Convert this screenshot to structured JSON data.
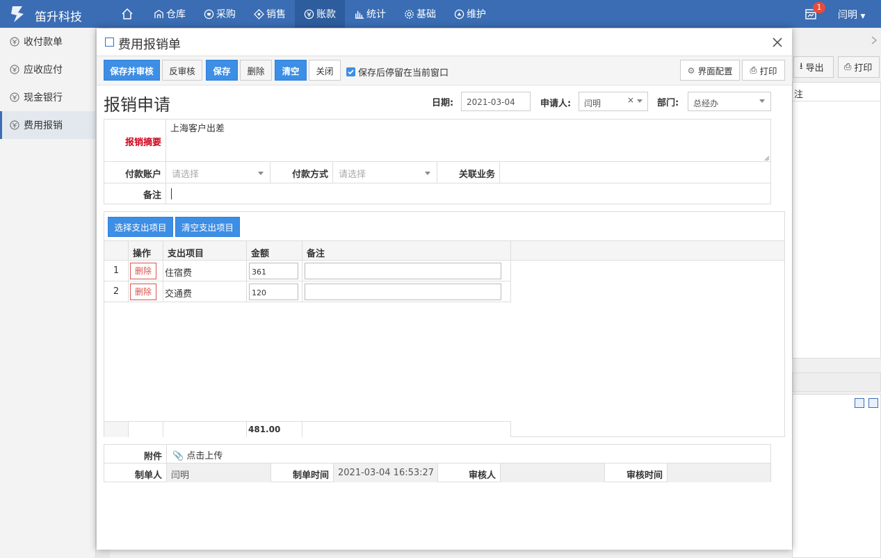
{
  "app": {
    "brand": "笛升科技",
    "user": "闫明",
    "notification_count": "1"
  },
  "nav": [
    "仓库",
    "采购",
    "销售",
    "账款",
    "统计",
    "基础",
    "维护"
  ],
  "sidebar": [
    "收付款单",
    "应收应付",
    "现金银行",
    "费用报销"
  ],
  "background": {
    "export": "导出",
    "print": "打印",
    "col": "注"
  },
  "modal": {
    "title": "费用报销单",
    "toolbar": {
      "save_audit": "保存并审核",
      "unaudit": "反审核",
      "save": "保存",
      "delete": "删除",
      "clear": "清空",
      "close": "关闭",
      "stay_label": "保存后停留在当前窗口",
      "ui_config": "界面配置",
      "print": "打印"
    },
    "heading": "报销申请",
    "date_label": "日期:",
    "date_value": "2021-03-04",
    "applicant_label": "申请人:",
    "applicant_value": "闫明",
    "dept_label": "部门:",
    "dept_value": "总经办",
    "summary_label": "报销摘要",
    "summary_value": "上海客户出差",
    "pay_account_label": "付款账户",
    "pay_account_placeholder": "请选择",
    "pay_method_label": "付款方式",
    "pay_method_placeholder": "请选择",
    "related_label": "关联业务",
    "remark_label": "备注",
    "items": {
      "select_btn": "选择支出项目",
      "clear_btn": "清空支出项目",
      "columns": [
        "操作",
        "支出项目",
        "金额",
        "备注"
      ],
      "rows": [
        {
          "index": "1",
          "action": "删除",
          "item": "住宿费",
          "amount": "361"
        },
        {
          "index": "2",
          "action": "删除",
          "item": "交通费",
          "amount": "120"
        }
      ],
      "total": "481.00"
    },
    "attachment_label": "附件",
    "upload_label": "点击上传",
    "creator_label": "制单人",
    "creator_value": "闫明",
    "created_time_label": "制单时间",
    "created_time_value": "2021-03-04 16:53:27",
    "auditor_label": "审核人",
    "audit_time_label": "审核时间"
  }
}
